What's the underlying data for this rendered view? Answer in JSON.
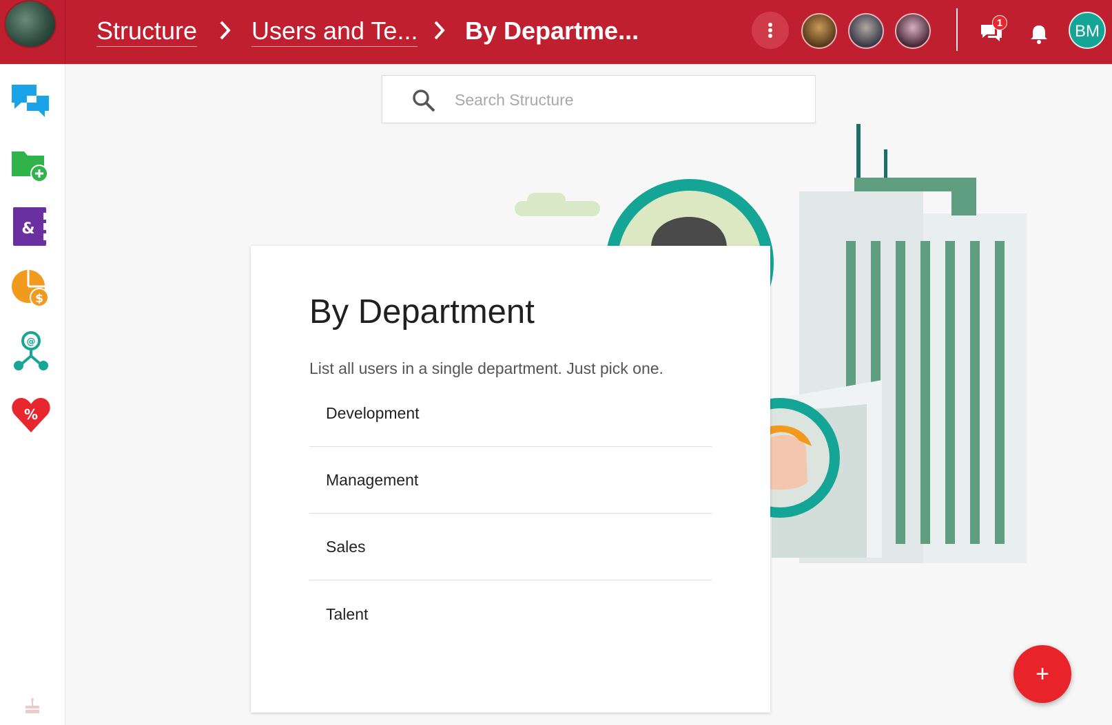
{
  "header": {
    "breadcrumbs": [
      {
        "label": "Structure"
      },
      {
        "label": "Users and Te..."
      },
      {
        "label": "By Departme..."
      }
    ],
    "chat_badge": "1",
    "user_initials": "BM"
  },
  "sidebar": {
    "items": [
      {
        "icon": "chat-icon",
        "color": "#1aa3e8"
      },
      {
        "icon": "folder-add-icon",
        "color": "#2fb34a"
      },
      {
        "icon": "contacts-book-icon",
        "color": "#6a2fa0"
      },
      {
        "icon": "finance-pie-icon",
        "color": "#f29a1d"
      },
      {
        "icon": "org-network-icon",
        "color": "#18a597"
      },
      {
        "icon": "heart-percent-icon",
        "color": "#e8262e"
      }
    ]
  },
  "search": {
    "placeholder": "Search Structure"
  },
  "card": {
    "title": "By Department",
    "subtitle": "List all users in a single department. Just pick one.",
    "departments": [
      "Development",
      "Management",
      "Sales",
      "Talent"
    ]
  },
  "fab": {
    "label": "+"
  },
  "colors": {
    "header": "#c01f2f",
    "accent_teal": "#15a596",
    "fab": "#e8232a"
  }
}
